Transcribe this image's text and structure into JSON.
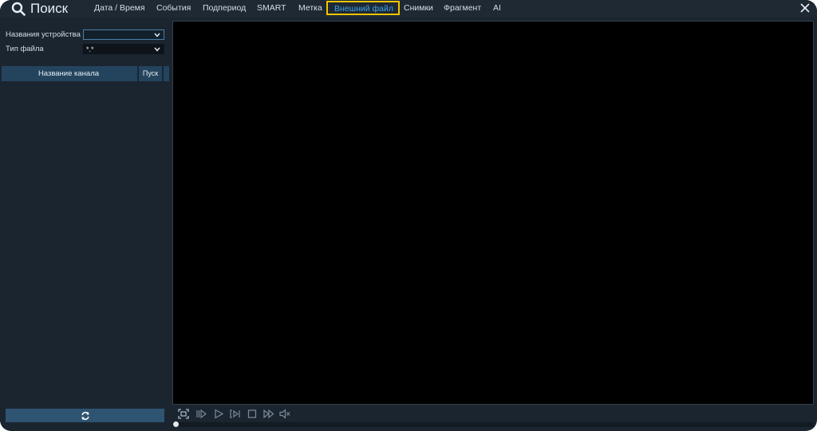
{
  "header": {
    "title": "Поиск",
    "tabs": [
      {
        "label": "Дата / Время"
      },
      {
        "label": "События"
      },
      {
        "label": "Подпериод"
      },
      {
        "label": "SMART"
      },
      {
        "label": "Метка"
      },
      {
        "label": "Внешний файл",
        "active": true
      },
      {
        "label": "Снимки"
      },
      {
        "label": "Фрагмент"
      },
      {
        "label": "AI"
      }
    ]
  },
  "sidebar": {
    "device_label": "Названия устройства",
    "device_value": "",
    "filetype_label": "Тип файла",
    "filetype_value": "*.*",
    "table": {
      "col_name": "Название канала",
      "col_start": "Пуск"
    }
  },
  "icons": {
    "search": "search-icon",
    "close": "close-icon",
    "refresh": "refresh-icon",
    "fullscreen": "fullscreen-icon",
    "rewind": "rewind-icon",
    "play": "play-icon",
    "step": "step-forward-icon",
    "stop": "stop-icon",
    "fast_forward": "fast-forward-icon",
    "audio": "audio-icon"
  },
  "colors": {
    "accent": "#3fa3f0",
    "active_tab_border": "#f2c400",
    "background": "#1b2530",
    "table_header": "#24445e",
    "button": "#2f5472"
  },
  "playback": {
    "progress": 0
  }
}
